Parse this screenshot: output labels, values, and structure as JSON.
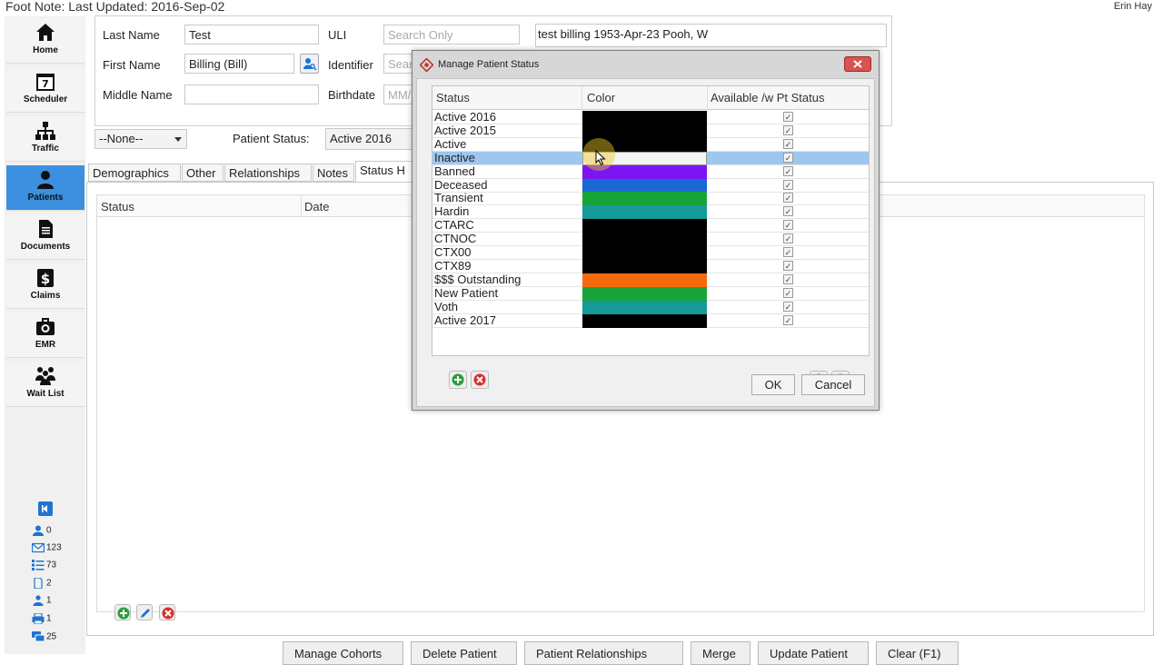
{
  "header": {
    "footnote": "Foot Note:  Last Updated: 2016-Sep-02",
    "user": "Erin Hay"
  },
  "sidebar": {
    "items": [
      {
        "label": "Home",
        "icon": "home-icon"
      },
      {
        "label": "Scheduler",
        "icon": "calendar-icon"
      },
      {
        "label": "Traffic",
        "icon": "org-chart-icon"
      },
      {
        "label": "Patients",
        "icon": "person-icon",
        "active": true
      },
      {
        "label": "Documents",
        "icon": "document-icon"
      },
      {
        "label": "Claims",
        "icon": "dollar-icon"
      },
      {
        "label": "EMR",
        "icon": "medical-bag-icon"
      },
      {
        "label": "Wait List",
        "icon": "group-icon"
      }
    ],
    "counts": [
      "0",
      "123",
      "73",
      "2",
      "1",
      "1",
      "25"
    ]
  },
  "form": {
    "last_name_label": "Last Name",
    "last_name": "Test",
    "first_name_label": "First Name",
    "first_name": "Billing (Bill)",
    "middle_name_label": "Middle Name",
    "middle_name": "",
    "uli_label": "ULI",
    "uli_placeholder": "Search Only",
    "identifier_label": "Identifier",
    "identifier_placeholder": "Sear",
    "birthdate_label": "Birthdate",
    "birthdate_placeholder": "MM/I",
    "summary": "test  billing    1953-Apr-23  Pooh, W",
    "cohort": "--None--",
    "patient_status_label": "Patient Status:",
    "patient_status": "Active 2016"
  },
  "tabs": [
    "Demographics",
    "Other",
    "Relationships",
    "Notes",
    "Status H"
  ],
  "history": {
    "col_status": "Status",
    "col_date": "Date"
  },
  "bottom_buttons": [
    "Manage Cohorts",
    "Delete Patient",
    "Patient Relationships",
    "Merge",
    "Update Patient",
    "Clear (F1)"
  ],
  "dialog": {
    "title": "Manage Patient Status",
    "col_status": "Status",
    "col_color": "Color",
    "col_available": "Available /w Pt Status",
    "rows": [
      {
        "name": "Active 2016",
        "color": "#000000",
        "checked": "✓"
      },
      {
        "name": "Active 2015",
        "color": "#000000",
        "checked": "✓"
      },
      {
        "name": "Active",
        "color": "#000000",
        "checked": "✓"
      },
      {
        "name": "Inactive",
        "color": "#f4f4f4",
        "checked": "✓",
        "selected": true
      },
      {
        "name": "Banned",
        "color": "#7b16f2",
        "checked": "✓"
      },
      {
        "name": "Deceased",
        "color": "#1a68d4",
        "checked": "✓"
      },
      {
        "name": "Transient",
        "color": "#17a33a",
        "checked": "✓"
      },
      {
        "name": "Hardin",
        "color": "#159a9a",
        "checked": "✓"
      },
      {
        "name": "CTARC",
        "color": "#000000",
        "checked": "✓"
      },
      {
        "name": "CTNOC",
        "color": "#000000",
        "checked": "✓"
      },
      {
        "name": "CTX00",
        "color": "#000000",
        "checked": "✓"
      },
      {
        "name": "CTX89",
        "color": "#000000",
        "checked": "✓"
      },
      {
        "name": "$$$ Outstanding",
        "color": "#f76a0c",
        "checked": "✓"
      },
      {
        "name": "New Patient",
        "color": "#1aa33a",
        "checked": "✓"
      },
      {
        "name": "Voth",
        "color": "#159a9a",
        "checked": "✓"
      },
      {
        "name": "Active 2017",
        "color": "#000000",
        "checked": "✓"
      }
    ],
    "ok_label": "OK",
    "cancel_label": "Cancel"
  }
}
